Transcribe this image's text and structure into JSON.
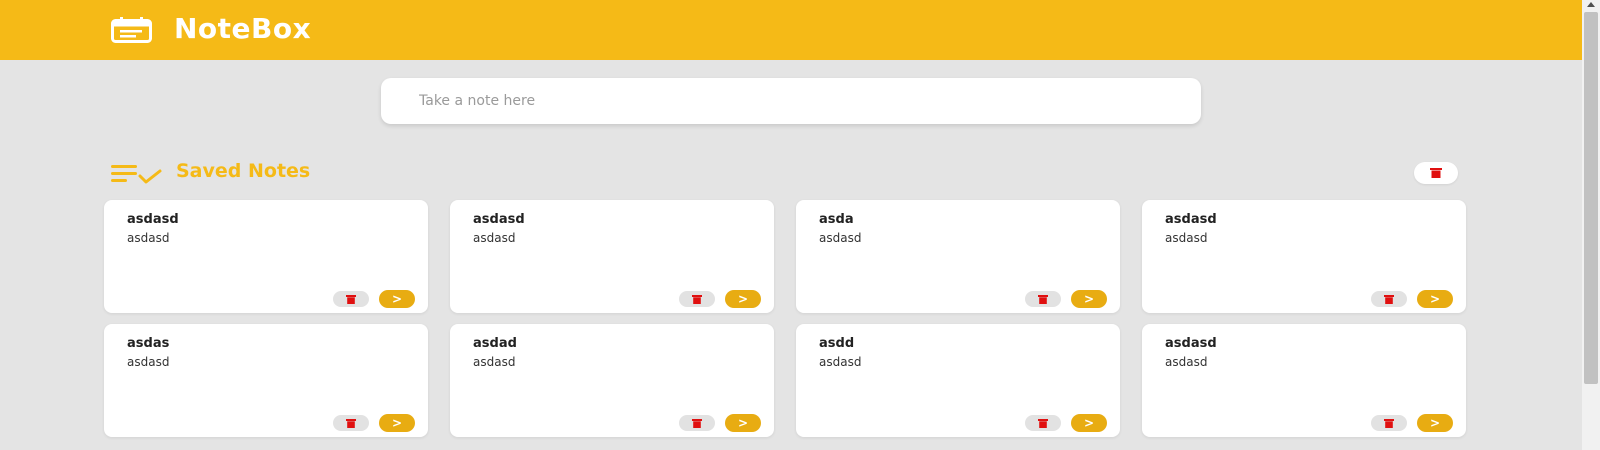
{
  "header": {
    "title": "NoteBox",
    "logo_icon": "notes-calendar-icon",
    "background_color": "#f5ba17"
  },
  "note_input": {
    "placeholder": "Take a note here",
    "value": ""
  },
  "saved_section": {
    "title": "Saved Notes",
    "icon": "list-check-icon",
    "clear_all_icon": "trash-icon",
    "accent_color": "#f5ba17"
  },
  "notes": [
    {
      "title": "asdasd",
      "body": "asdasd",
      "open_label": ">"
    },
    {
      "title": "asdasd",
      "body": "asdasd",
      "open_label": ">"
    },
    {
      "title": "asda",
      "body": "asdasd",
      "open_label": ">"
    },
    {
      "title": "asdasd",
      "body": "asdasd",
      "open_label": ">"
    },
    {
      "title": "asdas",
      "body": "asdasd",
      "open_label": ">"
    },
    {
      "title": "asdad",
      "body": "asdasd",
      "open_label": ">"
    },
    {
      "title": "asdd",
      "body": "asdasd",
      "open_label": ">"
    },
    {
      "title": "asdasd",
      "body": "asdasd",
      "open_label": ">"
    }
  ],
  "colors": {
    "delete_icon": "#e01010",
    "open_button": "#e8ac12",
    "page_background": "#e4e4e4"
  }
}
